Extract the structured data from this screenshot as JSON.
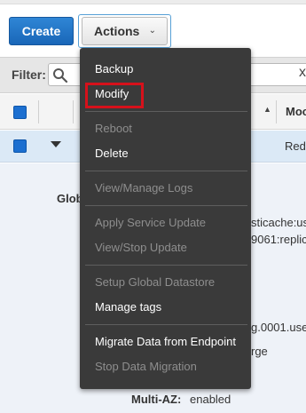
{
  "toolbar": {
    "create_label": "Create",
    "actions_label": "Actions",
    "actions_chevron": "⌄"
  },
  "filter": {
    "label": "Filter:",
    "clear_icon": "x"
  },
  "table": {
    "partial_column_header": "Moc",
    "row": {
      "partial_type": "Red"
    }
  },
  "details": {
    "partial_label_global": "Glob",
    "arn_fragment_1": "sticache:us",
    "arn_fragment_2": "9061:replic",
    "endpoint_fragment": "g.0001.use",
    "size_fragment": "rge",
    "multi_az_label": "Multi-AZ:",
    "multi_az_value": "enabled"
  },
  "actions_menu": {
    "backup": "Backup",
    "modify": "Modify",
    "reboot": "Reboot",
    "delete": "Delete",
    "view_manage_logs": "View/Manage Logs",
    "apply_service_update": "Apply Service Update",
    "view_stop_update": "View/Stop Update",
    "setup_global_datastore": "Setup Global Datastore",
    "manage_tags": "Manage tags",
    "migrate_data": "Migrate Data from Endpoint",
    "stop_data_migration": "Stop Data Migration"
  },
  "colors": {
    "primary_button": "#1966b8",
    "menu_background": "#3a3a3a",
    "highlight_outline": "#d6111b",
    "selected_row": "#dbe9f6"
  }
}
